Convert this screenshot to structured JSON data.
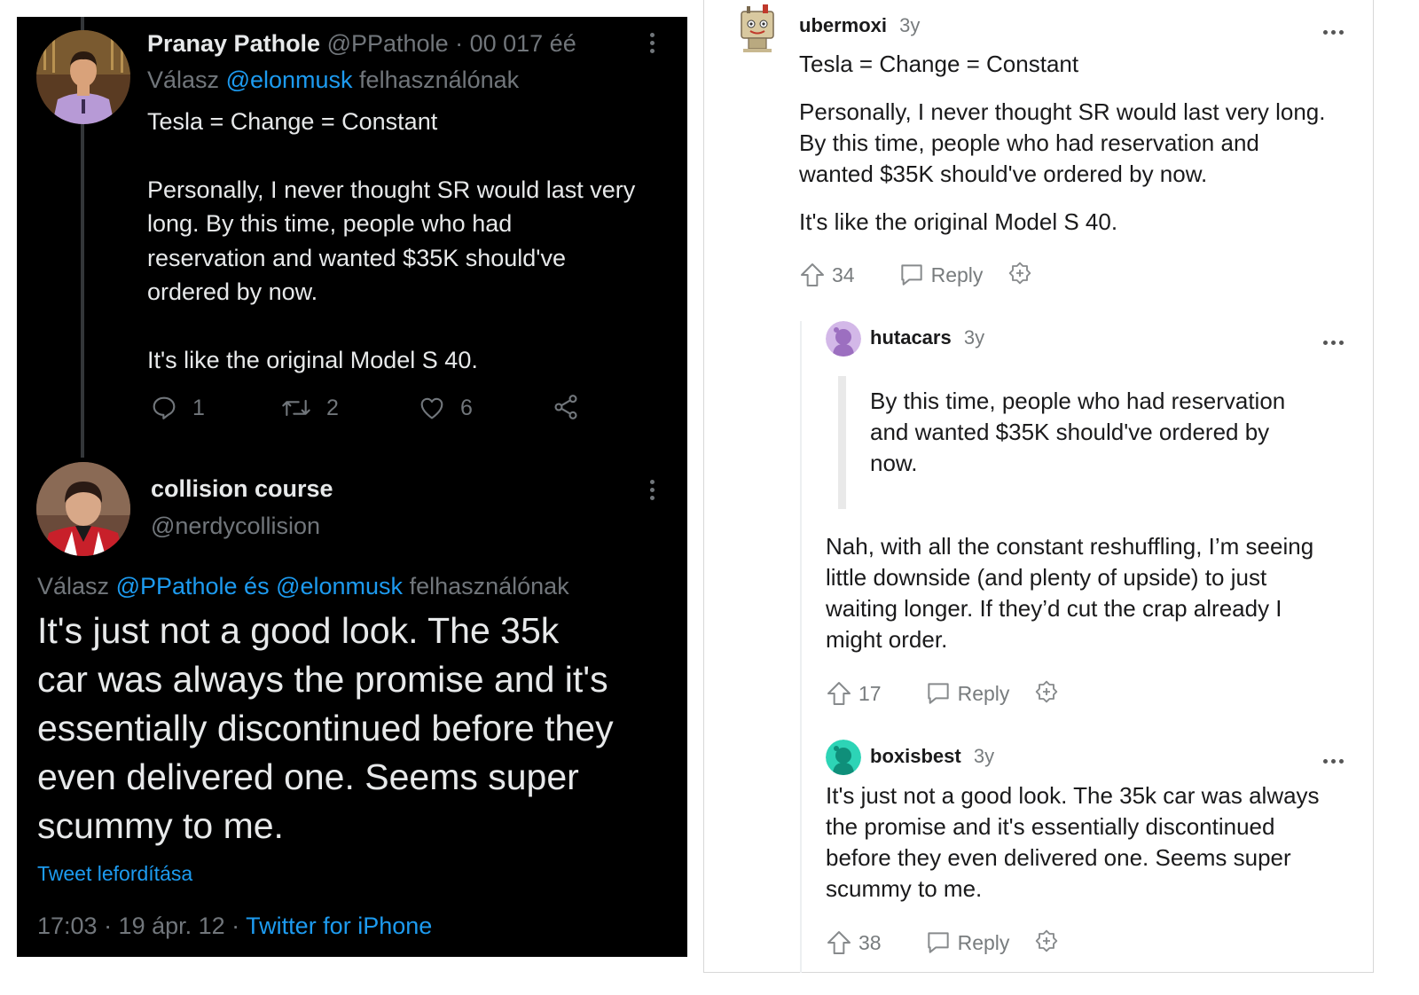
{
  "twitter": {
    "tweet1": {
      "name": "Pranay Pathole",
      "handle": "@PPathole",
      "meta": "· 00 017 éé",
      "reply_prefix": "Válasz",
      "reply_handle": "@elonmusk",
      "reply_suffix": "felhasználónak",
      "line1": "Tesla = Change = Constant",
      "para1_l1": "Personally, I never thought SR would last very",
      "para1_l2": "long.  By this time, people who had",
      "para1_l3": "reservation and wanted $35K should've",
      "para1_l4": "ordered by now.",
      "para2": "It's like the original Model S 40.",
      "replies": "1",
      "retweets": "2",
      "likes": "6"
    },
    "tweet2": {
      "name": "collision course",
      "handle": "@nerdycollision",
      "reply_prefix": "Válasz",
      "reply_handles": "@PPathole és @elonmusk",
      "reply_suffix": "felhasználónak",
      "l1": "It's just not a good look. The 35k",
      "l2": "car was always the promise and it's",
      "l3": "essentially discontinued before they",
      "l4": "even delivered one. Seems super",
      "l5": "scummy to me.",
      "translate": "Tweet lefordítása",
      "timestamp": "17:03 · 19 ápr. 12 ·",
      "source": "Twitter for iPhone"
    }
  },
  "reddit": {
    "c1": {
      "user": "ubermoxi",
      "age": "3y",
      "line1": "Tesla = Change = Constant",
      "p1_l1": "Personally, I never thought SR would last very long.",
      "p1_l2": "By this time, people who had reservation and",
      "p1_l3": "wanted $35K should've ordered by now.",
      "p2": "It's like the original Model S 40.",
      "votes": "34",
      "reply": "Reply"
    },
    "c2": {
      "user": "hutacars",
      "age": "3y",
      "q_l1": "By this time, people who had reservation",
      "q_l2": "and wanted $35K should've ordered by",
      "q_l3": "now.",
      "b_l1": "Nah, with all the constant reshuffling, I’m seeing",
      "b_l2": "little downside (and plenty of upside) to just",
      "b_l3": "waiting longer. If they’d cut the crap already I",
      "b_l4": "might order.",
      "votes": "17",
      "reply": "Reply"
    },
    "c3": {
      "user": "boxisbest",
      "age": "3y",
      "l1": "It's just not a good look. The 35k car was always",
      "l2": "the promise and it's essentially discontinued",
      "l3": "before they even delivered one. Seems super",
      "l4": "scummy to me.",
      "votes": "38",
      "reply": "Reply"
    }
  }
}
